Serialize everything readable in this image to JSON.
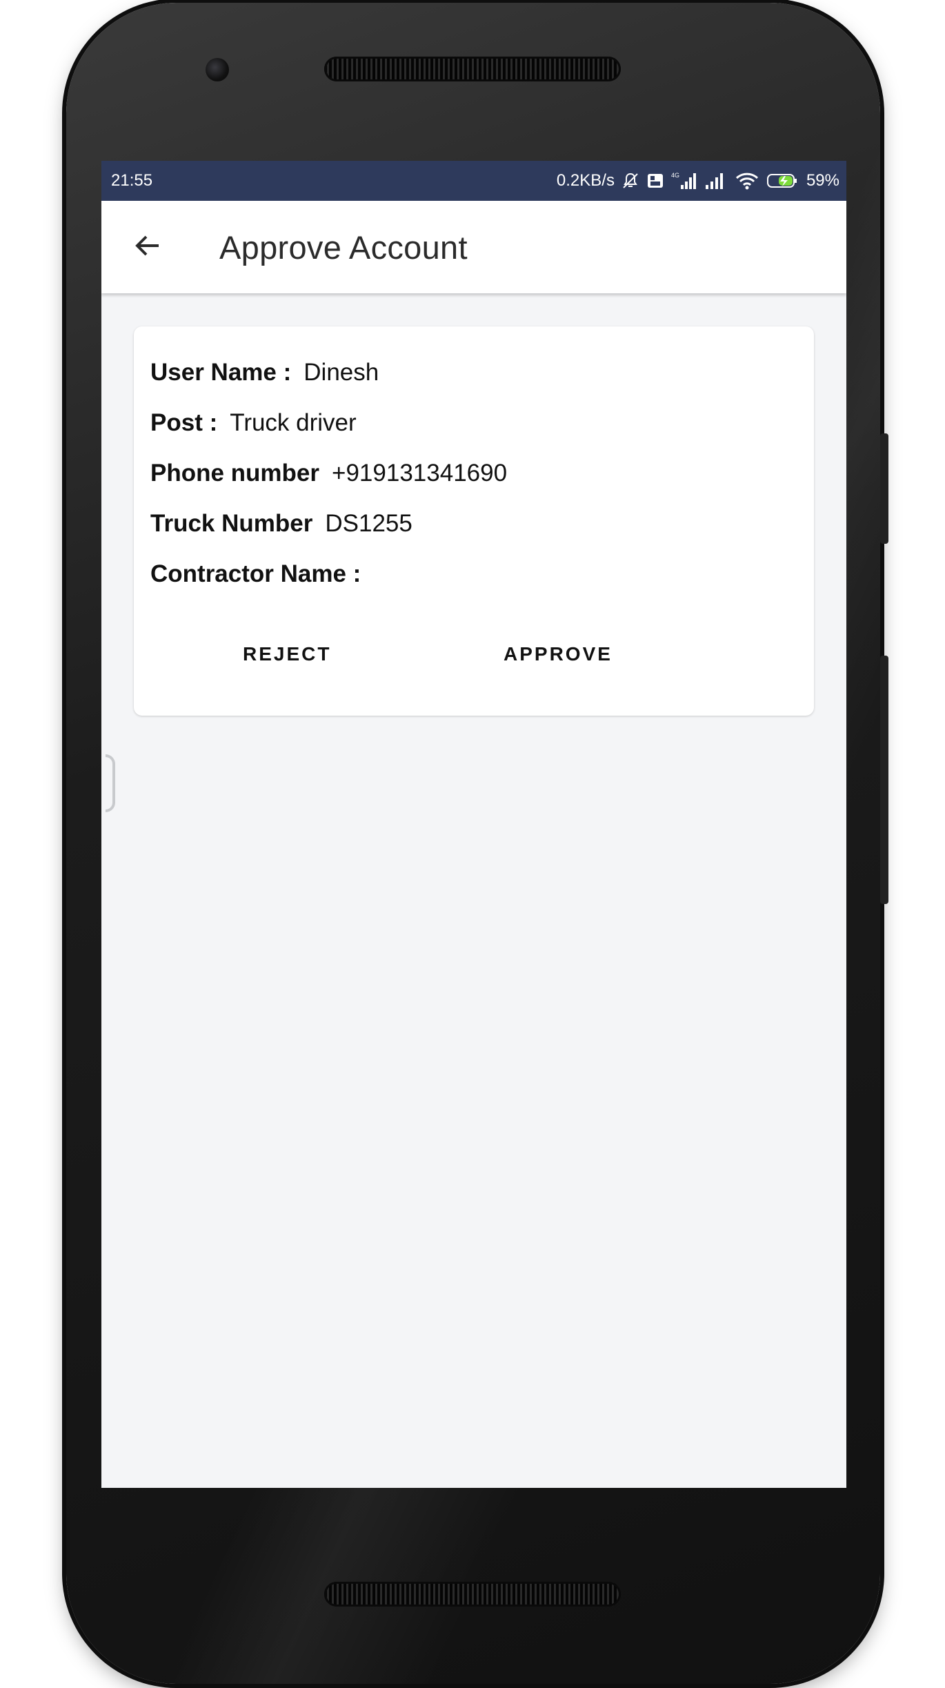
{
  "status_bar": {
    "time": "21:55",
    "net_speed": "0.2KB/s",
    "battery": "59%",
    "icons": [
      "mute-icon",
      "volte-icon",
      "4g-signal-icon",
      "signal-icon",
      "wifi-icon",
      "battery-charging-icon"
    ]
  },
  "app_bar": {
    "back_icon": "arrow-left-icon",
    "title": "Approve Account"
  },
  "card": {
    "rows": [
      {
        "label": "User Name :",
        "value": "Dinesh"
      },
      {
        "label": "Post :",
        "value": "Truck driver"
      },
      {
        "label": "Phone number",
        "value": "+919131341690"
      },
      {
        "label": "Truck Number",
        "value": "DS1255"
      },
      {
        "label": "Contractor Name :",
        "value": ""
      }
    ],
    "reject_label": "REJECT",
    "approve_label": "APPROVE"
  },
  "colors": {
    "status_bar": "#2e3a5c",
    "background": "#f4f5f7",
    "card": "#ffffff",
    "text": "#111111"
  }
}
